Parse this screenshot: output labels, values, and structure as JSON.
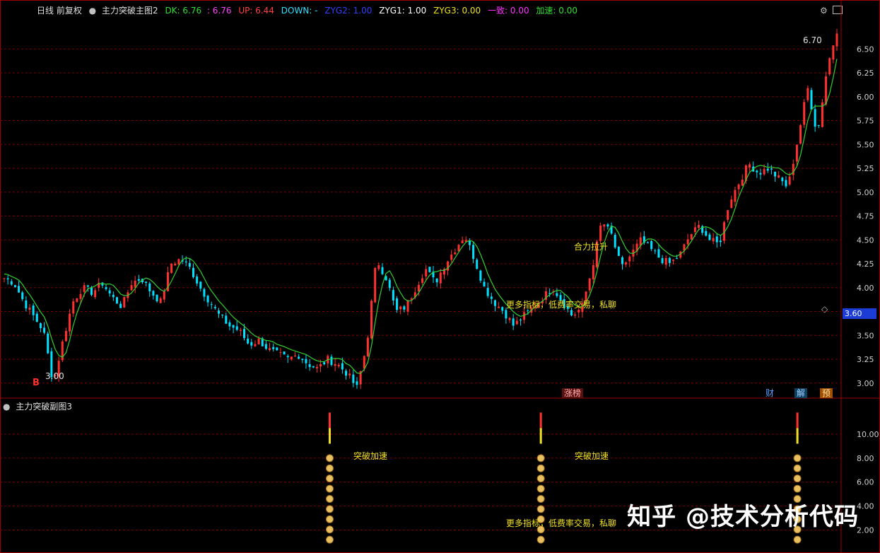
{
  "header": {
    "period_label": "日线 前复权",
    "indicator_name": "主力突破主图2",
    "dk": "DK: 6.76",
    "line2": ": 6.76",
    "up": "UP: 6.44",
    "down": "DOWN: -",
    "zyg2": "ZYG2: 1.00",
    "zyg1": "ZYG1: 1.00",
    "zyg3": "ZYG3: 0.00",
    "line_x": "一致: 0.00",
    "accel": "加速: 0.00"
  },
  "subpanel": {
    "title": "主力突破副图3",
    "signal_label": "突破加速",
    "bottom_text": "更多指标，低费率交易，私聊"
  },
  "annotations": {
    "max_price": "6.70",
    "min_price": "3.00",
    "current_price": "3.60",
    "main_text_1": "合力拉升",
    "main_text_2": "更多指标，低费率交易，私聊",
    "buy_marker": "B",
    "badge_limit": "涨榜",
    "badge_cai": "财",
    "badge_jie": "解",
    "badge_yu": "预"
  },
  "watermark": "知乎 @技术分析代码",
  "colors": {
    "up": "#ff3030",
    "down": "#00e0ff",
    "ma": "#30d030",
    "grid": "#7a0000",
    "axis": "#a00000"
  },
  "chart_data": [
    {
      "type": "candlestick",
      "title": "",
      "ylim": [
        2.85,
        6.85
      ],
      "yticks": [
        3.0,
        3.25,
        3.5,
        3.75,
        4.0,
        4.25,
        4.5,
        4.75,
        5.0,
        5.25,
        5.5,
        5.75,
        6.0,
        6.25,
        6.5
      ],
      "ytick_labels": [
        "3.00",
        "3.25",
        "3.50",
        "3.75",
        "4.00",
        "4.25",
        "4.50",
        "4.75",
        "5.00",
        "5.25",
        "5.50",
        "5.75",
        "6.00",
        "6.25",
        "6.50"
      ],
      "close_path": [
        4.1,
        4.05,
        3.85,
        3.7,
        3.55,
        3.0,
        3.45,
        3.85,
        4.0,
        3.95,
        4.05,
        3.9,
        3.8,
        4.05,
        4.1,
        3.95,
        3.85,
        4.25,
        4.3,
        4.2,
        4.0,
        3.85,
        3.7,
        3.6,
        3.55,
        3.4,
        3.45,
        3.35,
        3.3,
        3.25,
        3.3,
        3.2,
        3.15,
        3.25,
        3.2,
        3.1,
        2.95,
        3.4,
        4.3,
        4.1,
        3.75,
        3.8,
        4.0,
        4.2,
        4.05,
        4.25,
        4.4,
        4.55,
        4.3,
        4.0,
        3.85,
        3.75,
        3.6,
        3.7,
        3.8,
        3.9,
        4.0,
        3.85,
        3.7,
        3.8,
        4.2,
        4.7,
        4.55,
        4.2,
        4.35,
        4.5,
        4.4,
        4.3,
        4.25,
        4.35,
        4.55,
        4.65,
        4.5,
        4.45,
        4.9,
        5.1,
        5.3,
        5.2,
        5.25,
        5.15,
        5.05,
        5.55,
        6.1,
        5.6,
        6.3,
        6.7
      ]
    },
    {
      "type": "bar",
      "title": "",
      "ylim": [
        0.5,
        12
      ],
      "yticks": [
        2.0,
        4.0,
        6.0,
        8.0,
        10.0
      ],
      "ytick_labels": [
        "2.00",
        "4.00",
        "6.00",
        "8.00",
        "10.00"
      ],
      "signal_positions": [
        0.392,
        0.643,
        0.948
      ]
    }
  ]
}
